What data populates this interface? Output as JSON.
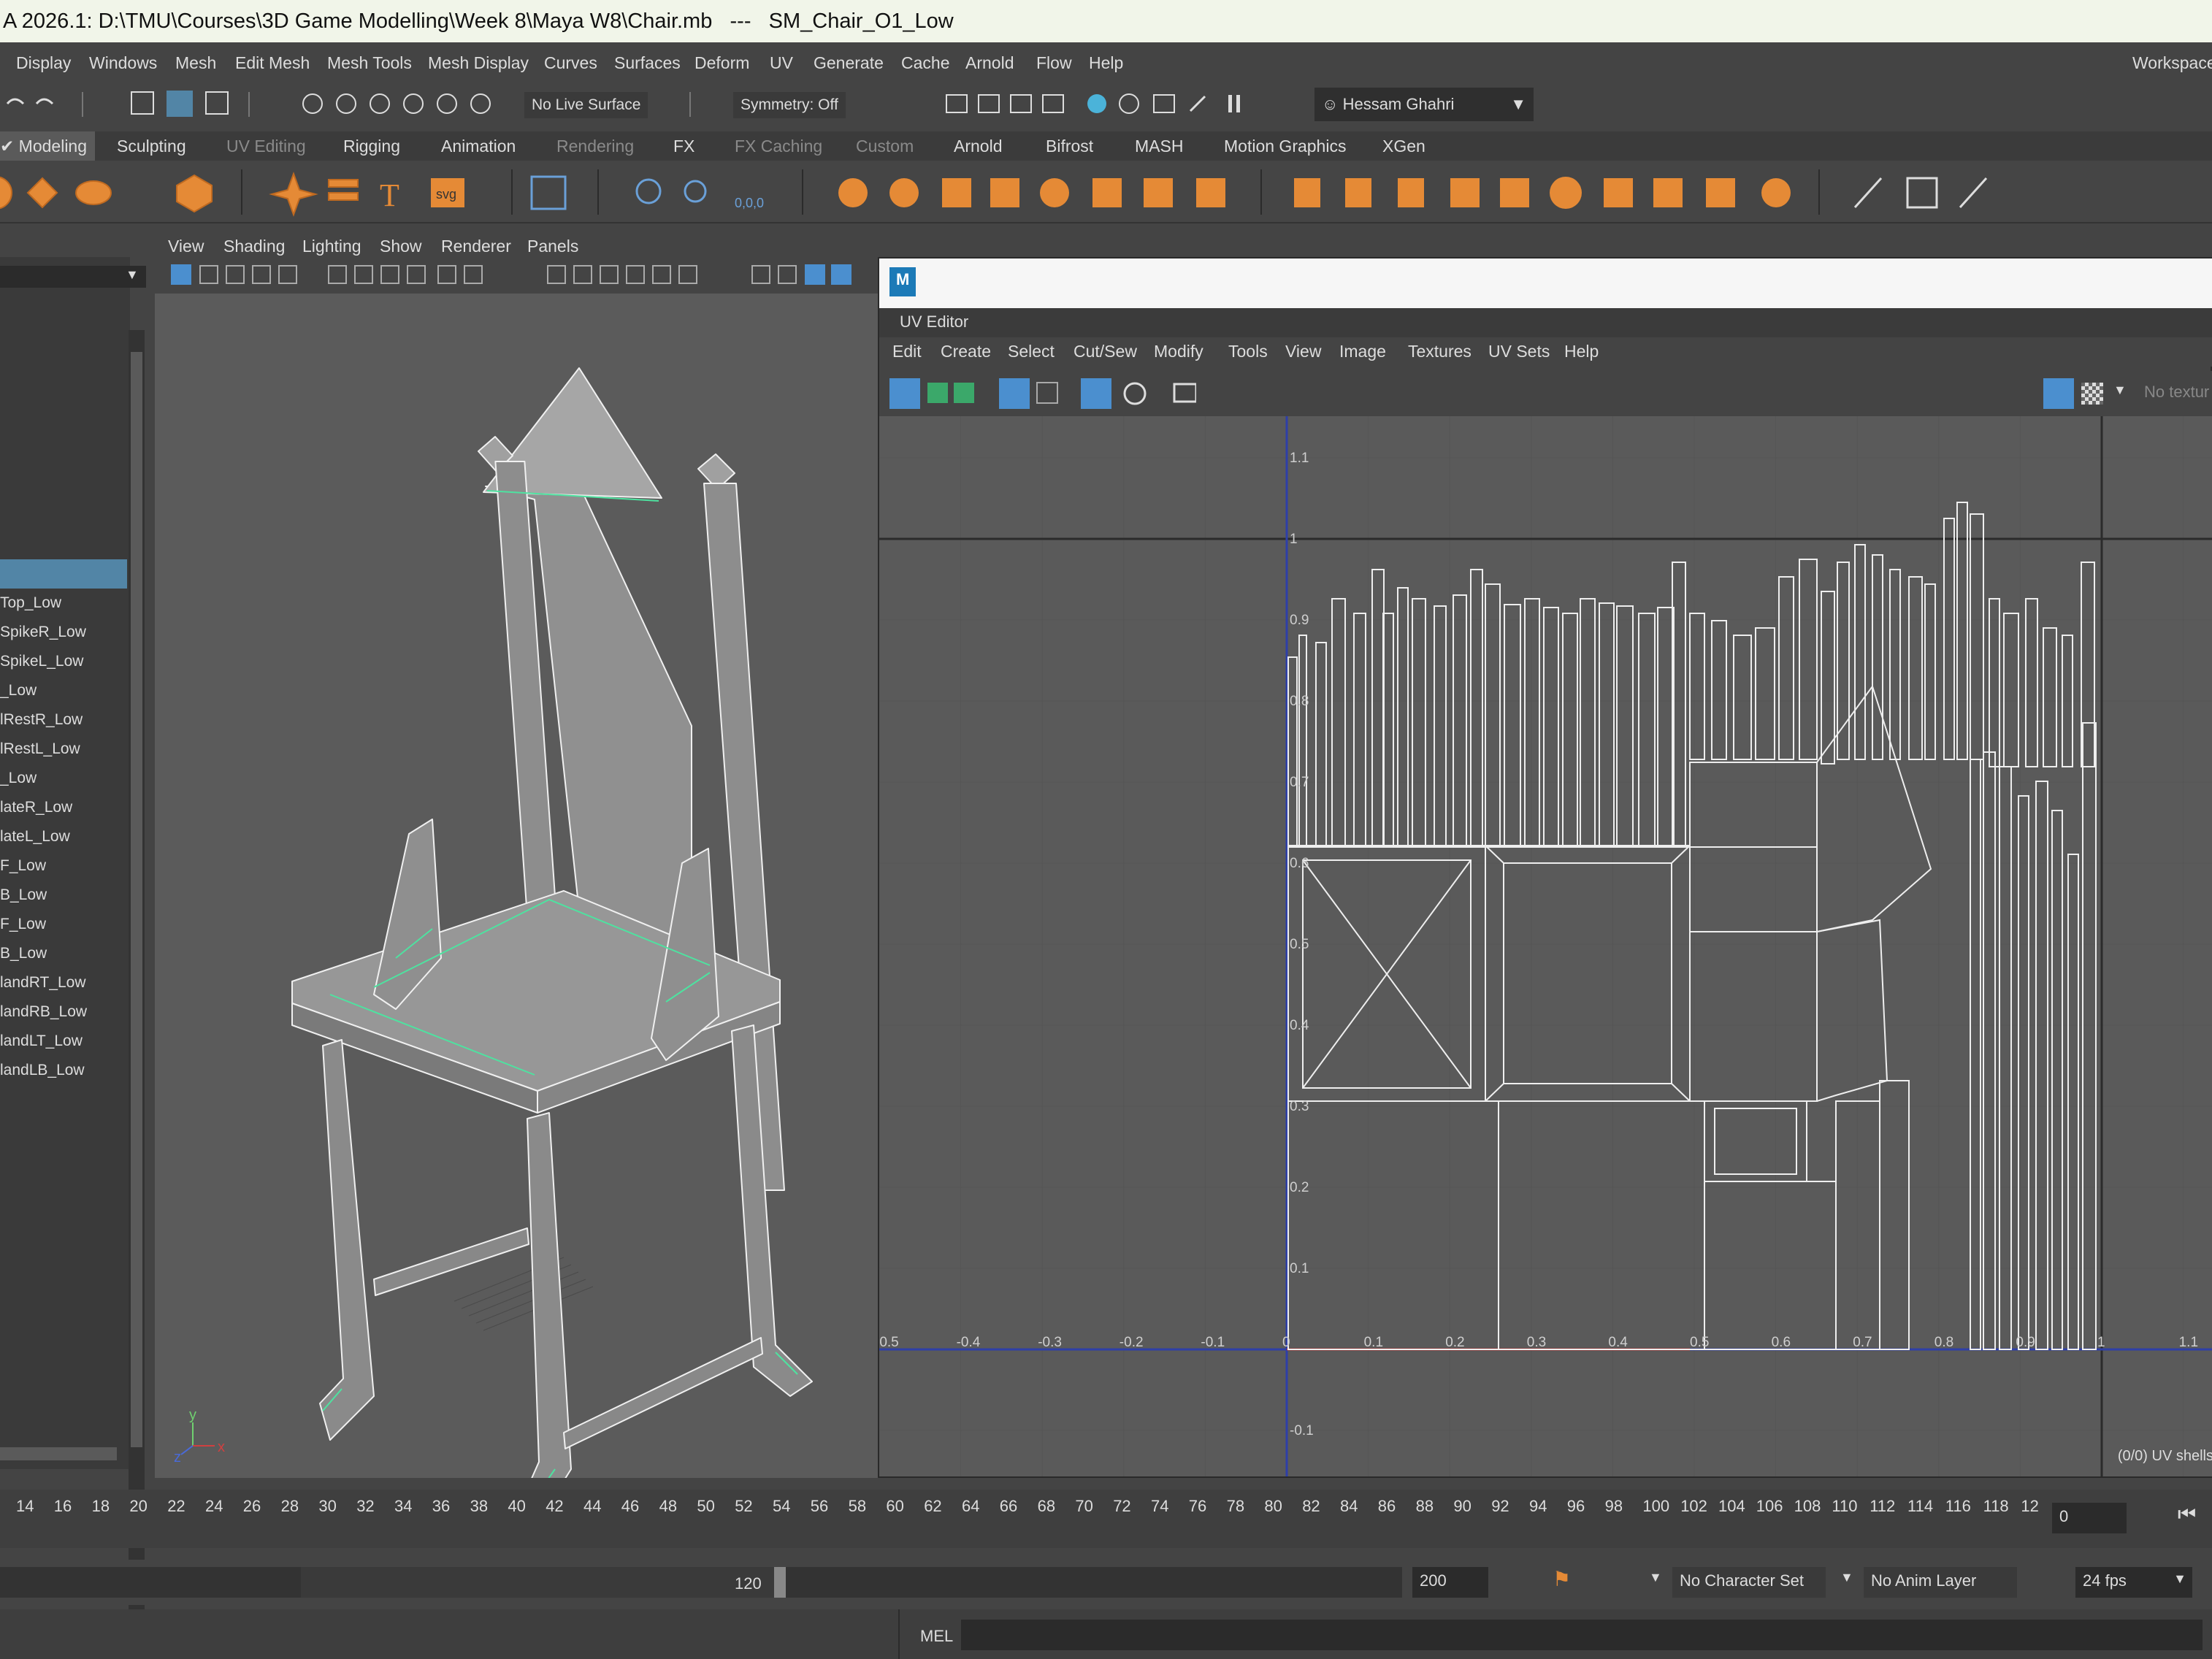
{
  "title_bar": {
    "text": "A 2026.1: D:\\TMU\\Courses\\3D Game Modelling\\Week 8\\Maya W8\\Chair.mb   ---   SM_Chair_O1_Low"
  },
  "menu": [
    "Display",
    "Windows",
    "Mesh",
    "Edit Mesh",
    "Mesh Tools",
    "Mesh Display",
    "Curves",
    "Surfaces",
    "Deform",
    "UV",
    "Generate",
    "Cache",
    "Arnold",
    "Flow",
    "Help"
  ],
  "workspace_label": "Workspace",
  "status_line": {
    "live_surface": "No Live Surface",
    "symmetry": "Symmetry: Off",
    "user": "Hessam Ghahri"
  },
  "shelf_tabs": [
    {
      "label": "Modeling",
      "active": true
    },
    {
      "label": "Sculpting"
    },
    {
      "label": "UV Editing",
      "dim": true
    },
    {
      "label": "Rigging"
    },
    {
      "label": "Animation"
    },
    {
      "label": "Rendering",
      "dim": true
    },
    {
      "label": "FX"
    },
    {
      "label": "FX Caching",
      "dim": true
    },
    {
      "label": "Custom",
      "dim": true
    },
    {
      "label": "Arnold"
    },
    {
      "label": "Bifrost"
    },
    {
      "label": "MASH"
    },
    {
      "label": "Motion Graphics"
    },
    {
      "label": "XGen"
    }
  ],
  "shelf_text_icons": {
    "text_tool": "T",
    "svg_tool": "svg",
    "coords": "0,0,0"
  },
  "outliner": {
    "items": [
      "Top_Low",
      "SpikeR_Low",
      "SpikeL_Low",
      "_Low",
      "lRestR_Low",
      "lRestL_Low",
      "_Low",
      "lateR_Low",
      "lateL_Low",
      "F_Low",
      "B_Low",
      "F_Low",
      "B_Low",
      "landRT_Low",
      "landRB_Low",
      "landLT_Low",
      "landLB_Low"
    ]
  },
  "viewport_menu": [
    "View",
    "Shading",
    "Lighting",
    "Show",
    "Renderer",
    "Panels"
  ],
  "axis_gizmo": {
    "y": "y",
    "x": "x",
    "z": "z"
  },
  "uv_editor": {
    "tab_label": "UV Editor",
    "menu": [
      "Edit",
      "Create",
      "Select",
      "Cut/Sew",
      "Modify",
      "Tools",
      "View",
      "Image",
      "Textures",
      "UV Sets",
      "Help"
    ],
    "no_texture": "No textur",
    "status": "(0/0) UV shells",
    "y_ticks": [
      "1.1",
      "1",
      "0.9",
      "0.8",
      "0.7",
      "0.6",
      "0.5",
      "0.4",
      "0.3",
      "0.2",
      "0.1",
      "-0.1"
    ],
    "x_ticks": [
      "-0.5",
      "-0.4",
      "-0.3",
      "-0.2",
      "-0.1",
      "0",
      "0.1",
      "0.2",
      "0.3",
      "0.4",
      "0.5",
      "0.6",
      "0.7",
      "0.8",
      "0.9",
      "1",
      "1.1"
    ]
  },
  "timeline": {
    "ticks": [
      "14",
      "16",
      "18",
      "20",
      "22",
      "24",
      "26",
      "28",
      "30",
      "32",
      "34",
      "36",
      "38",
      "40",
      "42",
      "44",
      "46",
      "48",
      "50",
      "52",
      "54",
      "56",
      "58",
      "60",
      "62",
      "64",
      "66",
      "68",
      "70",
      "72",
      "74",
      "76",
      "78",
      "80",
      "82",
      "84",
      "86",
      "88",
      "90",
      "92",
      "94",
      "96",
      "98",
      "100",
      "102",
      "104",
      "106",
      "108",
      "110",
      "112",
      "114",
      "116",
      "118",
      "12"
    ],
    "current_frame": "0"
  },
  "range": {
    "end": "120",
    "anim_end": "200",
    "character_set": "No Character Set",
    "anim_layer": "No Anim Layer",
    "fps": "24 fps"
  },
  "command_line": {
    "label": "MEL"
  },
  "colors": {
    "accent_orange": "#e58a36",
    "selection_blue": "#5285a6",
    "wire_green": "#4ee2a0",
    "uv_axis_blue": "#2e3fa8"
  }
}
